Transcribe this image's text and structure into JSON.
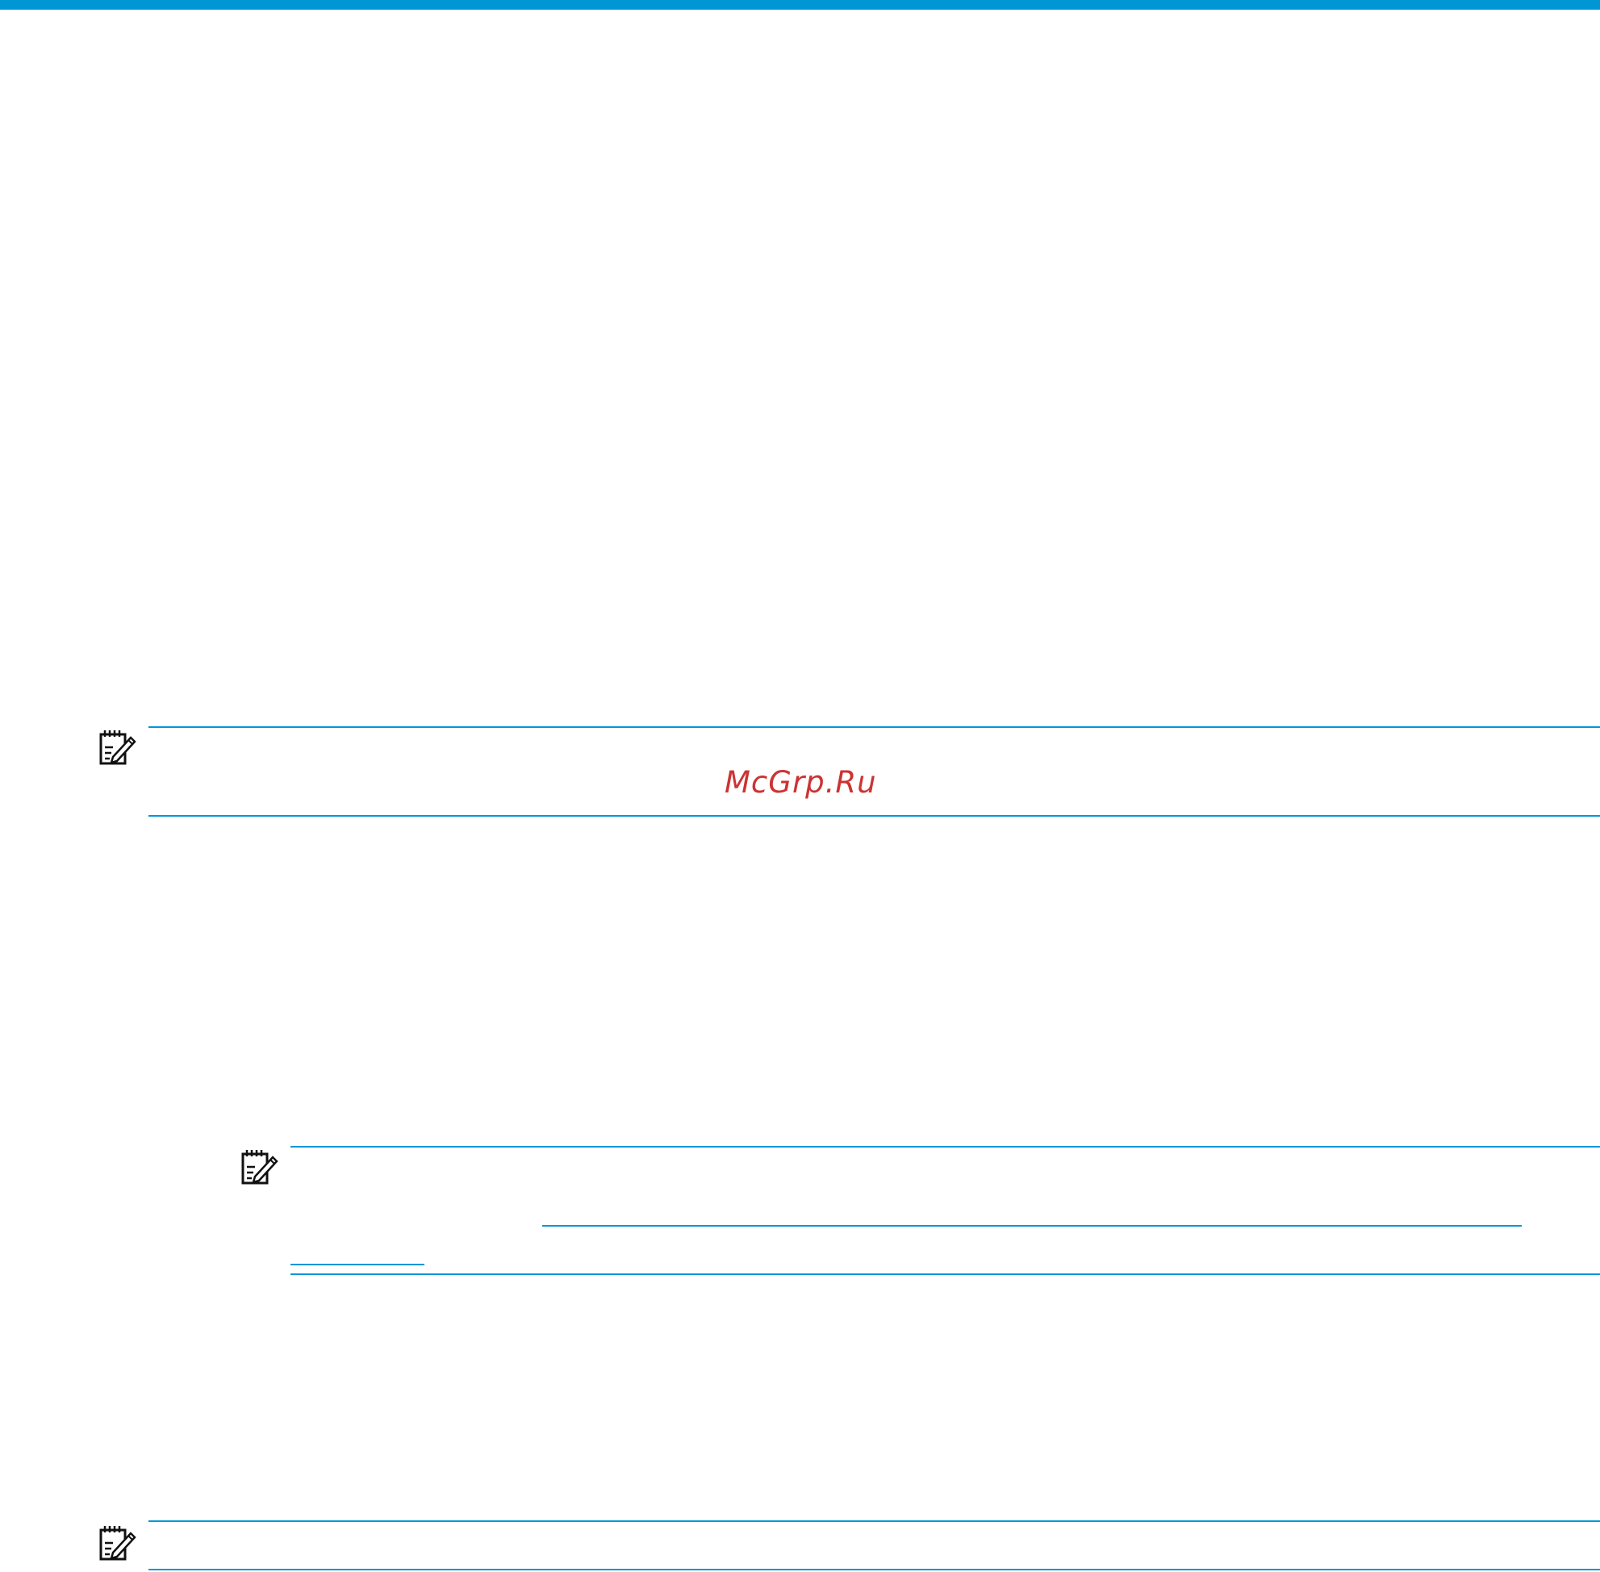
{
  "header": {
    "accent_color": "#0096d6"
  },
  "notes": [
    {
      "icon": "note-pencil-icon"
    },
    {
      "icon": "note-pencil-icon"
    },
    {
      "icon": "note-pencil-icon"
    }
  ],
  "watermark": {
    "text": "McGrp.Ru",
    "color": "#cc3333"
  }
}
